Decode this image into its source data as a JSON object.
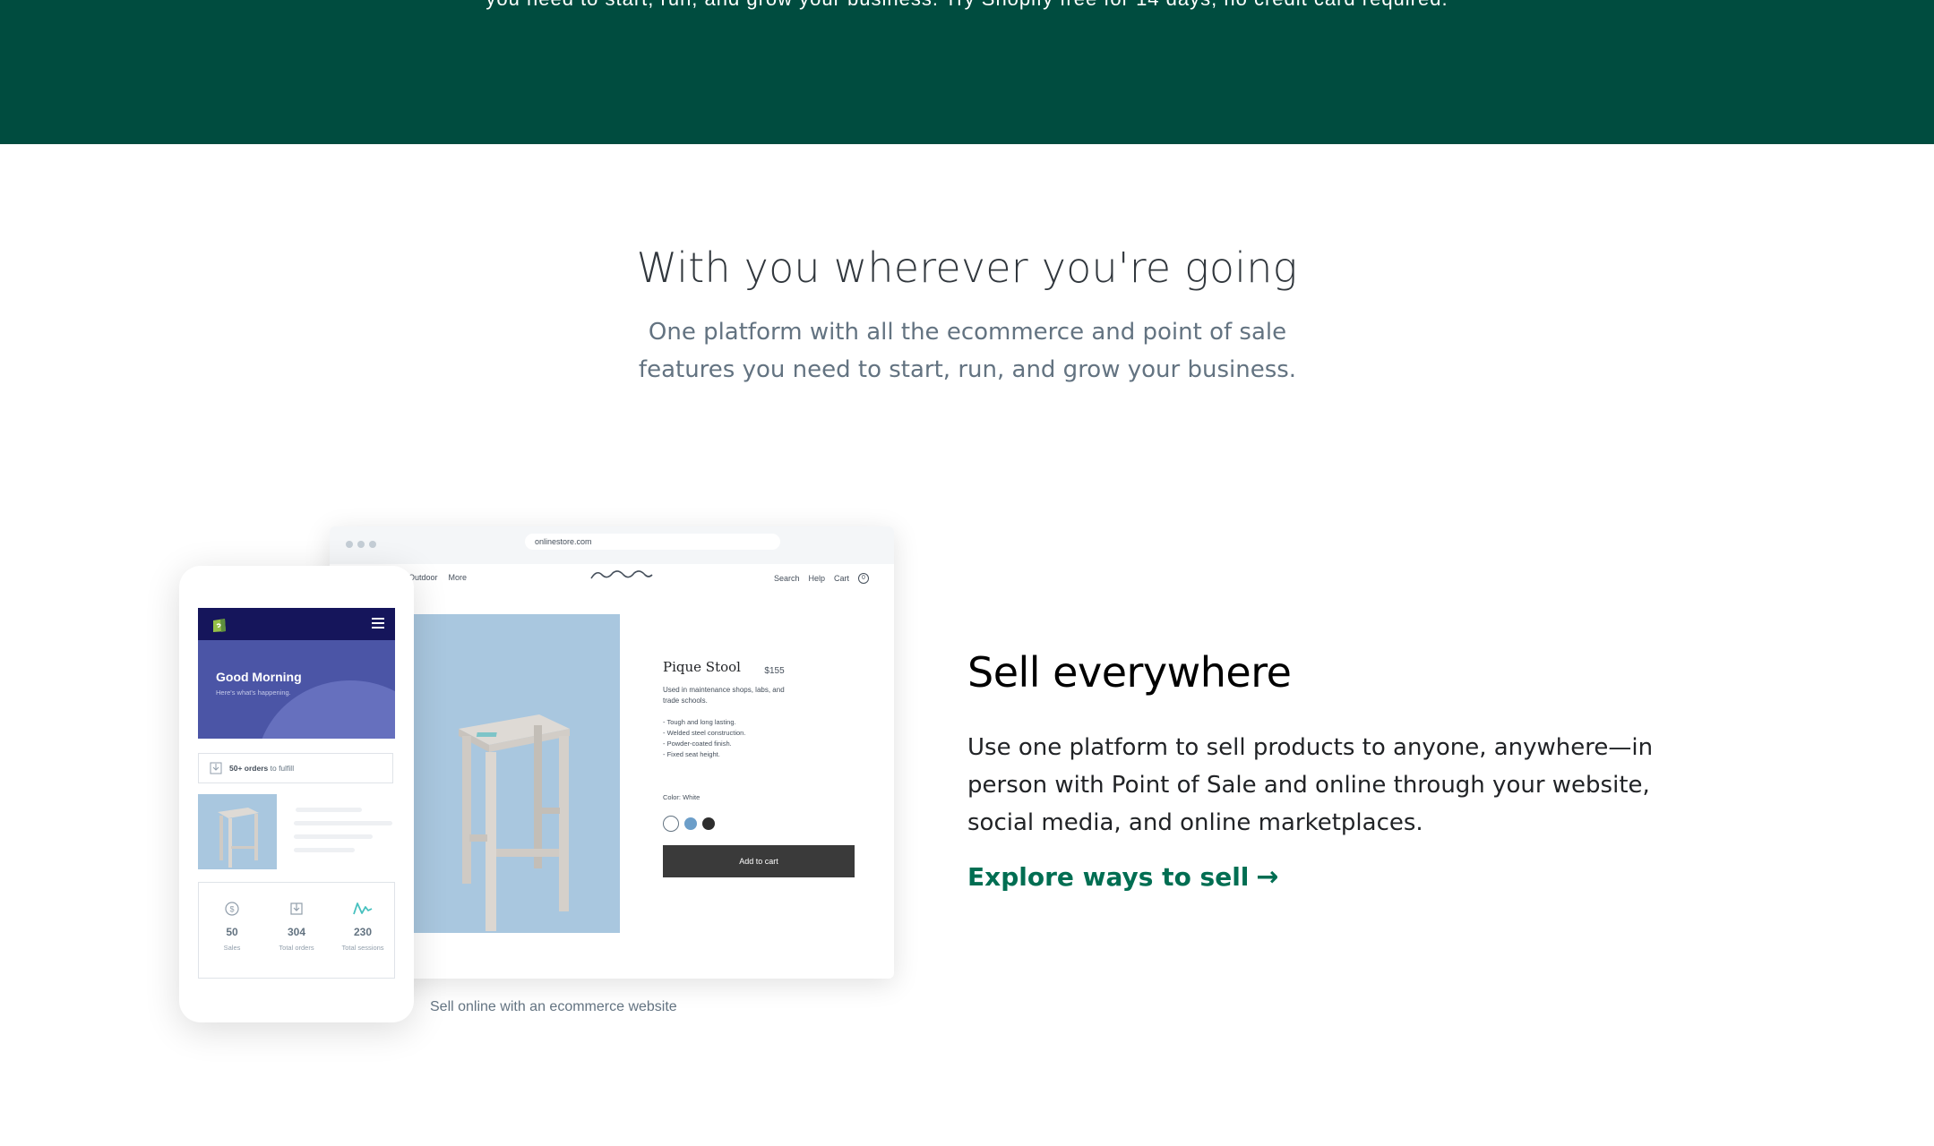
{
  "top_band": {
    "partial_text": "you need to start, run, and grow your business. Try Shopify free for 14 days, no credit card required."
  },
  "intro": {
    "headline": "With you wherever you're going",
    "subline": "One platform with all the ecommerce and point of sale features you need to start, run, and grow your business."
  },
  "illustration": {
    "browser": {
      "url": "onlinestore.com",
      "nav_left": [
        "Outdoor",
        "More"
      ],
      "nav_right": [
        "Search",
        "Help",
        "Cart"
      ],
      "cart_count": "0"
    },
    "product": {
      "title": "Pique Stool",
      "price": "$155",
      "description": "Used in maintenance shops, labs, and trade schools.",
      "bullets": [
        "- Tough and long lasting.",
        "- Welded steel construction.",
        "- Powder-coated finish.",
        "- Fixed seat height."
      ],
      "color_label": "Color: White",
      "swatch_colors": [
        "#ffffff",
        "#6c9ec9",
        "#2e2e2e"
      ],
      "add_to_cart": "Add to cart"
    },
    "phone": {
      "greeting": "Good Morning",
      "greeting_sub": "Here's what's happening.",
      "orders_bold": "50+ orders",
      "orders_rest": "to fulfill",
      "stats": [
        {
          "icon": "dollar-icon",
          "value": "50",
          "label": "Sales"
        },
        {
          "icon": "orders-icon",
          "value": "304",
          "label": "Total orders"
        },
        {
          "icon": "sessions-icon",
          "value": "230",
          "label": "Total sessions"
        }
      ]
    },
    "caption": "Sell online with an ecommerce website"
  },
  "feature": {
    "title": "Sell everywhere",
    "body": "Use one platform to sell products to anyone, anywhere—in person with Point of Sale and online through your website, social media, and online marketplaces.",
    "link_label": "Explore ways to sell",
    "link_arrow": "→",
    "link_color": "#006e52"
  },
  "colors": {
    "band": "#004c3f",
    "phone_header": "#15155b",
    "phone_hero": "#4b55a6",
    "product_bg": "#a9c7df"
  }
}
